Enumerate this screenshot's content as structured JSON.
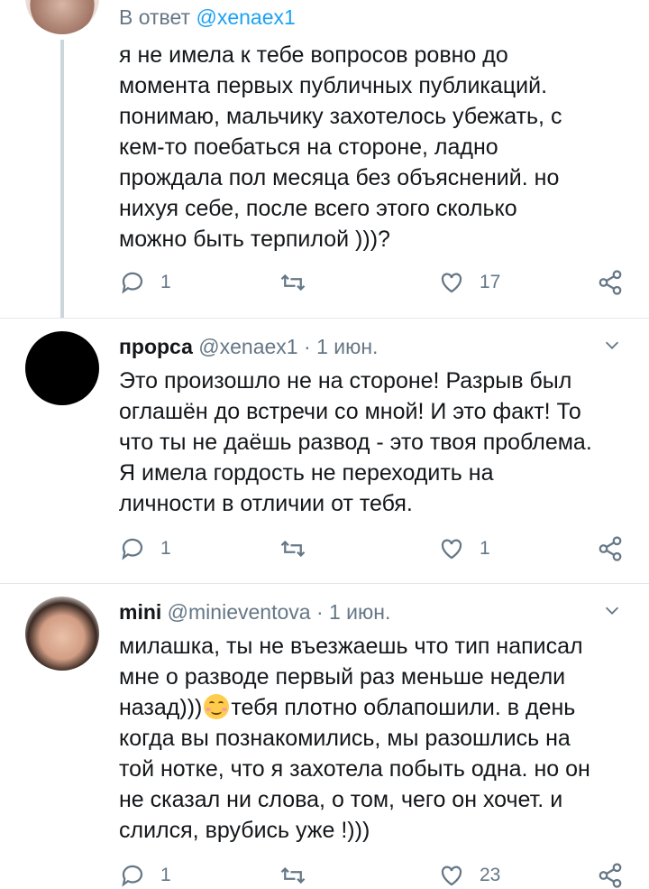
{
  "tweets": [
    {
      "reply_prefix": "В ответ",
      "reply_handle": "@xenaex1",
      "text": "я не имела к тебе вопросов ровно до\nмомента первых публичных публикаций.\nпонимаю, мальчику захотелось убежать, с\nкем-то поебаться на стороне, ладно\nпрождала пол месяца без объяснений. но\nнихуя себе, после всего этого сколько\nможно быть терпилой )))?",
      "replies": "1",
      "retweets": "",
      "likes": "17"
    },
    {
      "name": "прорса",
      "handle": "@xenaex1",
      "sep": "·",
      "date": "1 июн.",
      "text": "Это произошло не на стороне! Разрыв был\nоглашён до встречи со мной! И это факт! То\nчто ты не даёшь развод - это твоя проблема.\nЯ имела гордость не переходить на\nличности в отличии от тебя.",
      "replies": "1",
      "retweets": "",
      "likes": "1"
    },
    {
      "name": "mini",
      "handle": "@minieventova",
      "sep": "·",
      "date": "1 июн.",
      "text_a": "милашка, ты не въезжаешь что тип написал\nмне о разводе первый раз меньше недели\nназад)))",
      "text_b": "тебя плотно облапошили. в день\nкогда вы познакомились, мы разошлись на\nтой нотке, что я захотела побыть одна. но он\nне сказал ни слова, о том, чего он хочет. и\nслился, врубись уже !)))",
      "emoji": "smiling-face-with-blush",
      "replies": "1",
      "retweets": "",
      "likes": "23"
    }
  ],
  "colors": {
    "accent": "#1da1f2",
    "secondary": "#657786",
    "divider": "#e1e8ed"
  }
}
